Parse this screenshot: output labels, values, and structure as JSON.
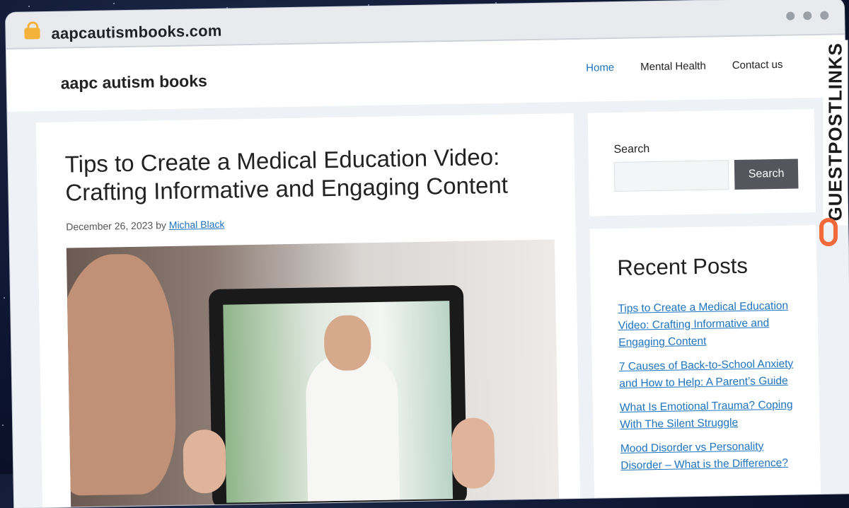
{
  "browser": {
    "url": "aapcautismbooks.com"
  },
  "site": {
    "title": "aapc autism books",
    "nav": [
      {
        "label": "Home",
        "active": true
      },
      {
        "label": "Mental Health",
        "active": false
      },
      {
        "label": "Contact us",
        "active": false
      }
    ]
  },
  "article": {
    "title": "Tips to Create a Medical Education Video: Crafting Informative and Engaging Content",
    "date": "December 26, 2023",
    "by": "by",
    "author": "Michal Black"
  },
  "search": {
    "label": "Search",
    "button": "Search",
    "value": ""
  },
  "recent_posts": {
    "heading": "Recent Posts",
    "items": [
      "Tips to Create a Medical Education Video: Crafting Informative and Engaging Content",
      "7 Causes of Back-to-School Anxiety and How to Help: A Parent’s Guide",
      "What Is Emotional Trauma? Coping With The Silent Struggle",
      "Mood Disorder vs Personality Disorder – What is the Difference?"
    ]
  },
  "watermark": {
    "text": "GUESTPOSTLINKS"
  },
  "colors": {
    "link": "#1e73be",
    "button": "#55555e",
    "accent": "#f26a3c"
  }
}
